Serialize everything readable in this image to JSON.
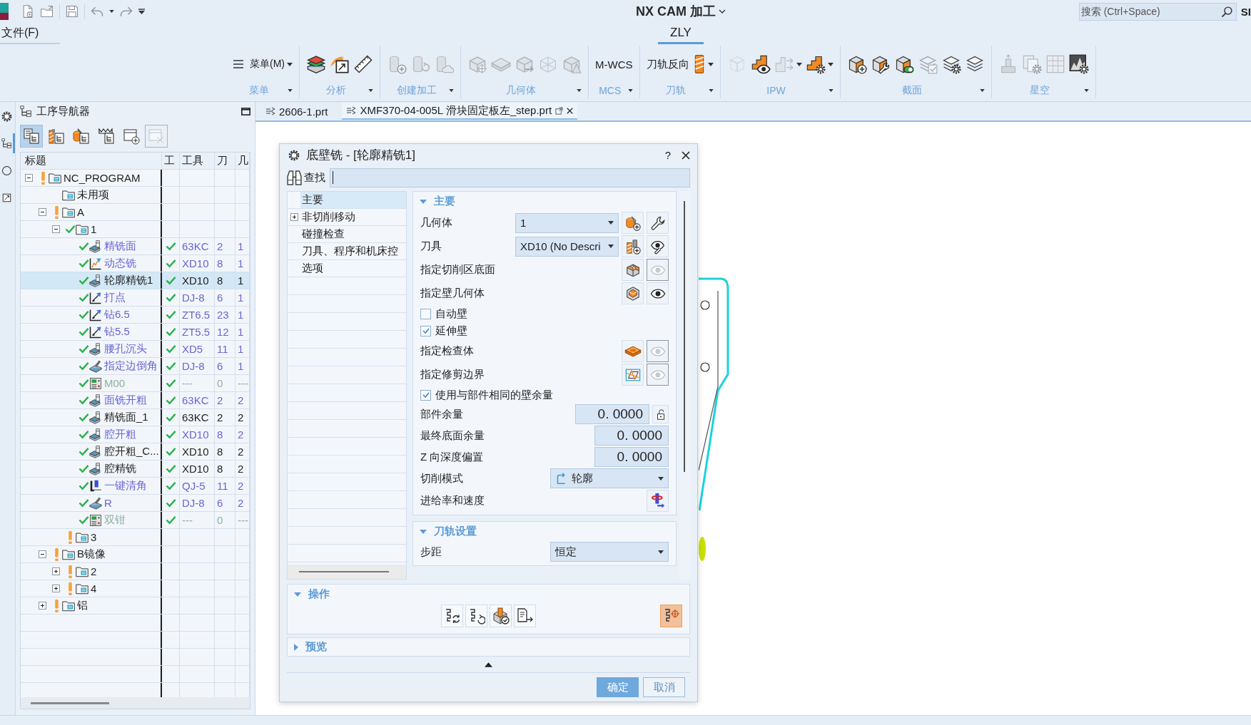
{
  "title_bar": {
    "title": "NX CAM 加工",
    "search": {
      "placeholder": "搜索 (Ctrl+Space)"
    },
    "edge_text": "SI"
  },
  "menu_bar": {
    "file_menu": "文件(F)",
    "tabs": [
      {
        "label": "ZLY",
        "selected": true
      }
    ]
  },
  "ribbon": {
    "groups": [
      {
        "label": "菜单",
        "tools": [
          {
            "kind": "menu",
            "label": "菜单(M)",
            "disabled": false,
            "dropdown": true
          }
        ]
      },
      {
        "label": "分析",
        "tools": [
          {
            "kind": "icon",
            "disabled": false,
            "dropdown": false
          },
          {
            "kind": "icon",
            "disabled": false,
            "dropdown": false
          },
          {
            "kind": "icon",
            "disabled": false,
            "dropdown": false
          }
        ]
      },
      {
        "label": "创建加工",
        "tools": [
          {
            "kind": "icon",
            "disabled": true,
            "dropdown": false
          },
          {
            "kind": "icon",
            "disabled": true,
            "dropdown": false
          },
          {
            "kind": "icon",
            "disabled": true,
            "dropdown": false
          }
        ]
      },
      {
        "label": "几何体",
        "tools": [
          {
            "kind": "icon",
            "disabled": true,
            "dropdown": false
          },
          {
            "kind": "icon",
            "disabled": true,
            "dropdown": false
          },
          {
            "kind": "icon",
            "disabled": true,
            "dropdown": false
          },
          {
            "kind": "icon",
            "disabled": true,
            "dropdown": false
          },
          {
            "kind": "icon",
            "disabled": true,
            "dropdown": false
          }
        ]
      },
      {
        "label": "MCS",
        "tools": [
          {
            "kind": "text",
            "label": "M-WCS",
            "disabled": false,
            "dropdown": false
          }
        ]
      },
      {
        "label": "刀轨",
        "tools": [
          {
            "kind": "text",
            "label": "刀轨反向",
            "disabled": false,
            "dropdown": false
          },
          {
            "kind": "icon",
            "disabled": false,
            "dropdown": true
          }
        ]
      },
      {
        "label": "IPW",
        "tools": [
          {
            "kind": "icon",
            "disabled": true,
            "dropdown": false
          },
          {
            "kind": "icon",
            "disabled": false,
            "dropdown": false
          },
          {
            "kind": "icon",
            "disabled": true,
            "dropdown": true
          },
          {
            "kind": "icon",
            "disabled": false,
            "dropdown": true
          }
        ]
      },
      {
        "label": "截面",
        "tools": [
          {
            "kind": "icon",
            "disabled": false,
            "dropdown": false
          },
          {
            "kind": "icon",
            "disabled": false,
            "dropdown": false
          },
          {
            "kind": "icon",
            "disabled": false,
            "dropdown": false
          },
          {
            "kind": "icon",
            "disabled": true,
            "dropdown": false
          },
          {
            "kind": "icon",
            "disabled": false,
            "dropdown": false
          },
          {
            "kind": "icon",
            "disabled": false,
            "dropdown": false
          }
        ]
      },
      {
        "label": "星空",
        "tools": [
          {
            "kind": "icon",
            "disabled": true,
            "dropdown": false
          },
          {
            "kind": "icon",
            "disabled": true,
            "dropdown": false
          },
          {
            "kind": "icon",
            "disabled": true,
            "dropdown": false
          },
          {
            "kind": "icon",
            "disabled": false,
            "dropdown": false
          }
        ]
      }
    ]
  },
  "panel_tabs": [
    {
      "selected": false
    },
    {
      "selected": true
    },
    {
      "selected": false
    },
    {
      "selected": false
    }
  ],
  "navigator": {
    "title": "工序导航器",
    "toolbar": [
      {
        "selected": true,
        "disabled": false
      },
      {
        "selected": false,
        "disabled": false
      },
      {
        "selected": false,
        "disabled": false
      },
      {
        "selected": false,
        "disabled": false
      },
      {
        "selected": false,
        "disabled": false
      },
      {
        "selected": false,
        "disabled": true
      }
    ],
    "columns": [
      "标题",
      "工",
      "工具",
      "刀",
      "几"
    ],
    "tree": [
      {
        "label": "NC_PROGRAM",
        "kind": "folder",
        "warning": true,
        "done": false,
        "expander": true,
        "expanded": true,
        "selected": false,
        "children": [
          {
            "label": "未用项",
            "kind": "folder",
            "warning": false,
            "done": false,
            "expander": false,
            "selected": false
          },
          {
            "label": "A",
            "kind": "folder",
            "warning": true,
            "done": false,
            "expander": true,
            "expanded": true,
            "selected": false,
            "children": [
              {
                "label": "1",
                "kind": "folder",
                "warning": false,
                "done": true,
                "expander": true,
                "expanded": true,
                "selected": false,
                "children": [
                  {
                    "label": "精铣面",
                    "kind": "mill",
                    "warning": false,
                    "done": true,
                    "expander": false,
                    "selected": false,
                    "color": "#6a64d4",
                    "column_2_ok": true,
                    "cells": [
                      "63KC",
                      "2",
                      "1"
                    ]
                  },
                  {
                    "label": "动态铣",
                    "kind": "dynamic",
                    "warning": false,
                    "done": true,
                    "expander": false,
                    "selected": false,
                    "color": "#6a64d4",
                    "column_2_ok": true,
                    "cells": [
                      "XD10",
                      "8",
                      "1"
                    ]
                  },
                  {
                    "label": "轮廓精铣1",
                    "kind": "mill",
                    "warning": false,
                    "done": true,
                    "expander": false,
                    "selected": true,
                    "color": "#1e1e1e",
                    "column_2_ok": true,
                    "cells": [
                      "XD10",
                      "8",
                      "1"
                    ]
                  },
                  {
                    "label": "打点",
                    "kind": "drill",
                    "warning": false,
                    "done": true,
                    "expander": false,
                    "selected": false,
                    "color": "#6a64d4",
                    "column_2_ok": true,
                    "cells": [
                      "DJ-8",
                      "6",
                      "1"
                    ]
                  },
                  {
                    "label": "钻6.5",
                    "kind": "drill",
                    "warning": false,
                    "done": true,
                    "expander": false,
                    "selected": false,
                    "color": "#6a64d4",
                    "column_2_ok": true,
                    "cells": [
                      "ZT6.5",
                      "23",
                      "1"
                    ]
                  },
                  {
                    "label": "钻5.5",
                    "kind": "drill",
                    "warning": false,
                    "done": true,
                    "expander": false,
                    "selected": false,
                    "color": "#6a64d4",
                    "column_2_ok": true,
                    "cells": [
                      "ZT5.5",
                      "12",
                      "1"
                    ]
                  },
                  {
                    "label": "腰孔沉头",
                    "kind": "mill",
                    "warning": false,
                    "done": true,
                    "expander": false,
                    "selected": false,
                    "color": "#6a64d4",
                    "column_2_ok": true,
                    "cells": [
                      "XD5",
                      "11",
                      "1"
                    ]
                  },
                  {
                    "label": "指定边倒角",
                    "kind": "chamfer",
                    "warning": false,
                    "done": true,
                    "expander": false,
                    "selected": false,
                    "color": "#6a64d4",
                    "column_2_ok": true,
                    "cells": [
                      "DJ-8",
                      "6",
                      "1"
                    ]
                  },
                  {
                    "label": "M00",
                    "kind": "machine",
                    "warning": false,
                    "done": true,
                    "expander": false,
                    "selected": false,
                    "color": "#8fb0a0",
                    "column_2_ok": true,
                    "cells": [
                      "---",
                      "0",
                      "---"
                    ]
                  },
                  {
                    "label": "面铣开粗",
                    "kind": "mill",
                    "warning": false,
                    "done": true,
                    "expander": false,
                    "selected": false,
                    "color": "#6a64d4",
                    "column_2_ok": true,
                    "cells": [
                      "63KC",
                      "2",
                      "2"
                    ]
                  },
                  {
                    "label": "精铣面_1",
                    "kind": "mill",
                    "warning": false,
                    "done": true,
                    "expander": false,
                    "selected": false,
                    "color": "#1e1e1e",
                    "column_2_ok": true,
                    "cells": [
                      "63KC",
                      "2",
                      "2"
                    ]
                  },
                  {
                    "label": "腔开粗",
                    "kind": "mill",
                    "warning": false,
                    "done": true,
                    "expander": false,
                    "selected": false,
                    "color": "#6a64d4",
                    "column_2_ok": true,
                    "cells": [
                      "XD10",
                      "8",
                      "2"
                    ]
                  },
                  {
                    "label": "腔开粗_C...",
                    "kind": "mill",
                    "warning": false,
                    "done": true,
                    "expander": false,
                    "selected": false,
                    "color": "#1e1e1e",
                    "column_2_ok": true,
                    "cells": [
                      "XD10",
                      "8",
                      "2"
                    ]
                  },
                  {
                    "label": "腔精铣",
                    "kind": "mill",
                    "warning": false,
                    "done": true,
                    "expander": false,
                    "selected": false,
                    "color": "#1e1e1e",
                    "column_2_ok": true,
                    "cells": [
                      "XD10",
                      "8",
                      "2"
                    ]
                  },
                  {
                    "label": "一键清角",
                    "kind": "corner",
                    "warning": false,
                    "done": true,
                    "expander": false,
                    "selected": false,
                    "color": "#6a64d4",
                    "column_2_ok": true,
                    "cells": [
                      "QJ-5",
                      "11",
                      "2"
                    ]
                  },
                  {
                    "label": "R",
                    "kind": "chamfer",
                    "warning": false,
                    "done": true,
                    "expander": false,
                    "selected": false,
                    "color": "#6a64d4",
                    "column_2_ok": true,
                    "cells": [
                      "DJ-8",
                      "6",
                      "2"
                    ]
                  },
                  {
                    "label": "双钳",
                    "kind": "machine",
                    "warning": false,
                    "done": true,
                    "expander": false,
                    "selected": false,
                    "color": "#8fb0a0",
                    "column_2_ok": true,
                    "cells": [
                      "---",
                      "0",
                      "---"
                    ]
                  }
                ]
              },
              {
                "label": "3",
                "kind": "folder",
                "warning": true,
                "done": false,
                "expander": false,
                "selected": false
              }
            ]
          },
          {
            "label": "B镜像",
            "kind": "folder",
            "warning": true,
            "done": false,
            "expander": true,
            "expanded": true,
            "selected": false,
            "children": [
              {
                "label": "2",
                "kind": "folder",
                "warning": true,
                "done": false,
                "expander": true,
                "expanded": false,
                "selected": false
              },
              {
                "label": "4",
                "kind": "folder",
                "warning": true,
                "done": false,
                "expander": true,
                "expanded": false,
                "selected": false
              }
            ]
          },
          {
            "label": "铝",
            "kind": "folder",
            "warning": true,
            "done": false,
            "expander": true,
            "expanded": false,
            "selected": false
          }
        ]
      }
    ]
  },
  "documents": [
    {
      "label": "2606-1.prt",
      "selected": false
    },
    {
      "label": "XMF370-04-005L 滑块固定板左_step.prt",
      "selected": true
    }
  ],
  "dialog": {
    "title": "底壁铣 - [轮廓精铣1]",
    "help": "?",
    "find": {
      "label": "查找",
      "focused": true
    },
    "nav": [
      {
        "label": "主要",
        "selected": true,
        "expander": false
      },
      {
        "label": "非切削移动",
        "selected": false,
        "expander": true,
        "expanded": false
      },
      {
        "label": "碰撞检查",
        "selected": false,
        "expander": false
      },
      {
        "label": "刀具、程序和机床控",
        "selected": false,
        "expander": false
      },
      {
        "label": "选项",
        "selected": false,
        "expander": false
      }
    ],
    "sections": [
      {
        "title": "主要",
        "expanded": true,
        "rows": [
          {
            "kind": "select_pair",
            "label": "几何体",
            "value": "1"
          },
          {
            "kind": "select_pair",
            "label": "刀具",
            "value": "XD10 (No Descri"
          },
          {
            "kind": "pick",
            "label": "指定切削区底面",
            "display": false
          },
          {
            "kind": "pick",
            "label": "指定壁几何体",
            "display": true
          },
          {
            "kind": "check",
            "label": "自动壁",
            "checked": false
          },
          {
            "kind": "check",
            "label": "延伸壁",
            "checked": true
          },
          {
            "kind": "pick",
            "label": "指定检查体",
            "display": false
          },
          {
            "kind": "pick",
            "label": "指定修剪边界",
            "display": false
          },
          {
            "kind": "check",
            "label": "使用与部件相同的壁余量",
            "checked": true
          },
          {
            "kind": "number_lock",
            "label": "部件余量",
            "value": "0. 0000",
            "locked": false
          },
          {
            "kind": "number",
            "label": "最终底面余量",
            "value": "0. 0000"
          },
          {
            "kind": "number",
            "label": "Z 向深度偏置",
            "value": "0. 0000"
          },
          {
            "kind": "mode_select",
            "label": "切削模式",
            "value": "轮廓"
          },
          {
            "kind": "button",
            "label": "进给率和速度"
          }
        ]
      },
      {
        "title": "刀轨设置",
        "expanded": true,
        "rows": [
          {
            "kind": "select",
            "label": "步距",
            "value": "恒定"
          }
        ]
      }
    ],
    "actions": {
      "title": "操作",
      "expanded": true,
      "buttons": [
        {
          "selected": false
        },
        {
          "selected": false
        },
        {
          "selected": false
        },
        {
          "selected": false
        },
        {
          "selected": true
        }
      ]
    },
    "preview": {
      "title": "预览",
      "expanded": false
    },
    "buttons": [
      {
        "label": "确定",
        "kind": "primary"
      },
      {
        "label": "取消",
        "kind": "secondary"
      }
    ]
  }
}
